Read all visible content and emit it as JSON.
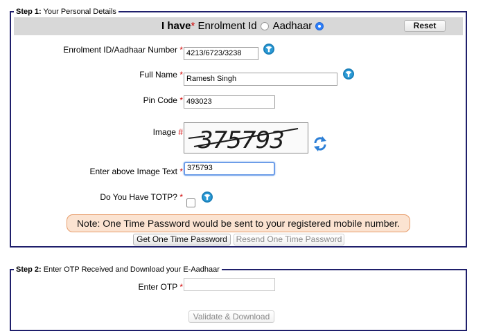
{
  "step1": {
    "legend_bold": "Step 1:",
    "legend_text": "Your Personal Details",
    "have_bold": "I have",
    "have_star": "*",
    "option_enrolment": "Enrolment Id",
    "option_aadhaar": "Aadhaar",
    "selected_option": "Aadhaar",
    "reset_label": "Reset",
    "id_label": "Enrolment ID/Aadhaar Number",
    "id_value": "4213/6723/3238",
    "name_label": "Full Name",
    "name_value": "Ramesh Singh",
    "pin_label": "Pin Code",
    "pin_value": "493023",
    "image_label": "Image",
    "image_marker": "#",
    "captcha_text": "375793",
    "image_text_label": "Enter above Image Text",
    "image_text_value": "375793",
    "totp_label": "Do You Have TOTP?",
    "totp_checked": false,
    "required_marker": "*",
    "note": "Note: One Time Password would be sent to your registered mobile number.",
    "get_otp_label": "Get One Time Password",
    "resend_otp_label": "Resend One Time Password"
  },
  "step2": {
    "legend_bold": "Step 2:",
    "legend_text": "Enter OTP Received and Download your E-Aadhaar",
    "otp_label": "Enter OTP",
    "otp_value": "",
    "validate_label": "Validate & Download"
  },
  "colors": {
    "border": "#1f1f6b",
    "note_bg": "#fbe3d1",
    "note_border": "#e79c6a",
    "radio_selected": "#2d7ff9",
    "info_icon": "#1b7fb8",
    "refresh_icon": "#2c7fd6"
  }
}
